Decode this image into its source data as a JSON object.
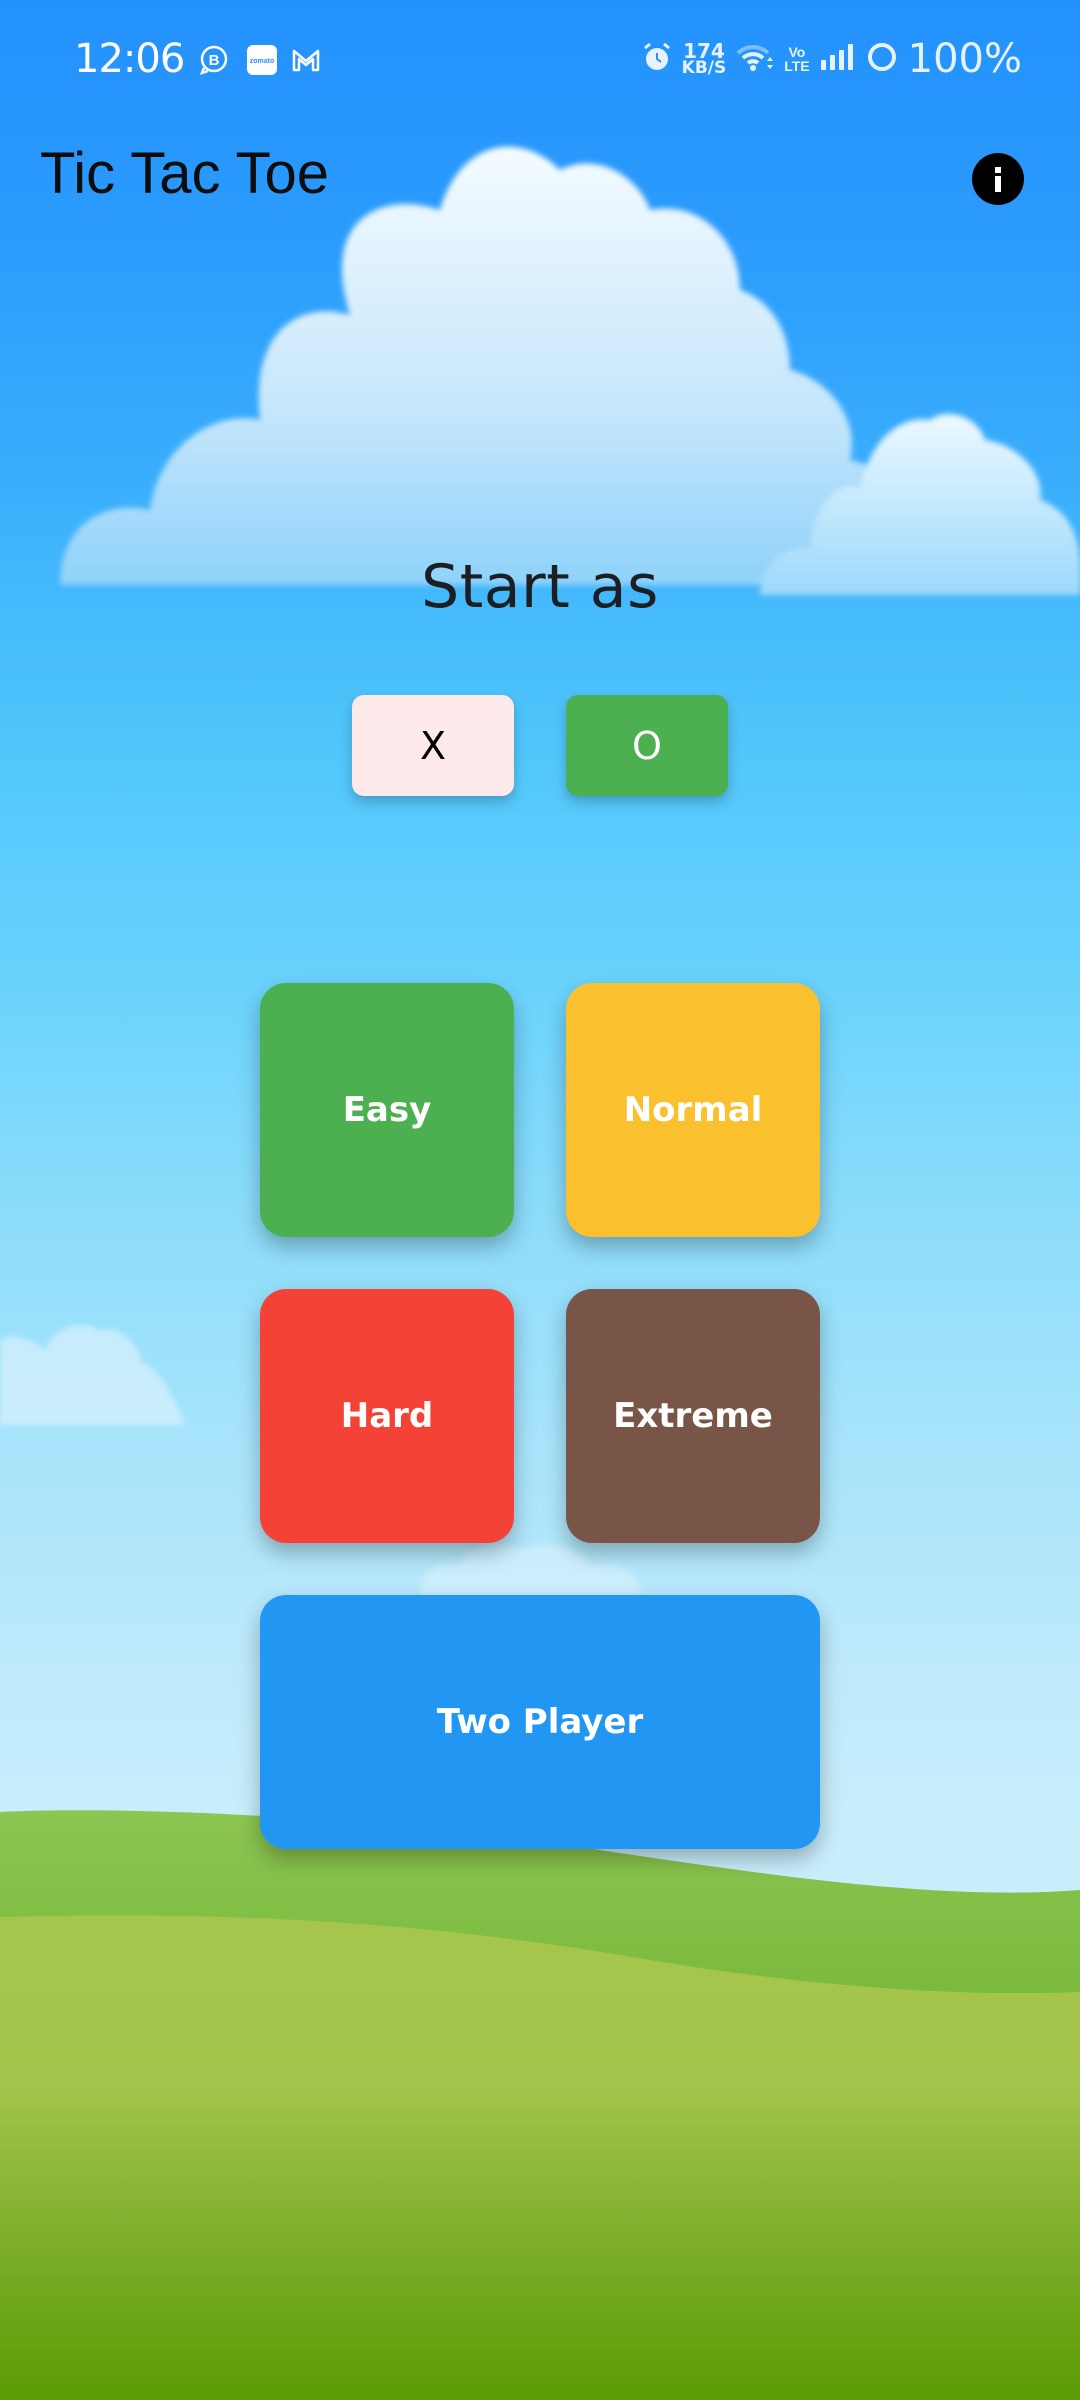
{
  "status_bar": {
    "time": "12:06",
    "notification_icons": [
      "whatsapp-business-icon",
      "zomato-icon",
      "gmail-icon"
    ],
    "zomato_label": "zomato",
    "alarm_icon": "alarm-icon",
    "network_speed_value": "174",
    "network_speed_unit": "KB/S",
    "wifi_icon": "wifi-icon",
    "volte_top": "Vo",
    "volte_bottom": "LTE",
    "signal_icon": "signal-icon",
    "battery_icon": "battery-ring-icon",
    "battery_percent": "100%"
  },
  "app_bar": {
    "title": "Tic Tac Toe",
    "info_icon": "info-icon"
  },
  "start_section": {
    "heading": "Start as",
    "options": [
      {
        "label": "X",
        "selected": false,
        "color": "#fde8ea"
      },
      {
        "label": "O",
        "selected": true,
        "color": "#4caf50"
      }
    ]
  },
  "modes": [
    {
      "label": "Easy",
      "color": "#4caf50"
    },
    {
      "label": "Normal",
      "color": "#fbc02d"
    },
    {
      "label": "Hard",
      "color": "#f44336"
    },
    {
      "label": "Extreme",
      "color": "#795548"
    },
    {
      "label": "Two Player",
      "color": "#2196f3"
    }
  ],
  "colors": {
    "sky_top": "#2391fd",
    "sky_bottom": "#c8eefc",
    "grass_light": "#a5c44c",
    "grass_dark": "#5a9b05"
  }
}
